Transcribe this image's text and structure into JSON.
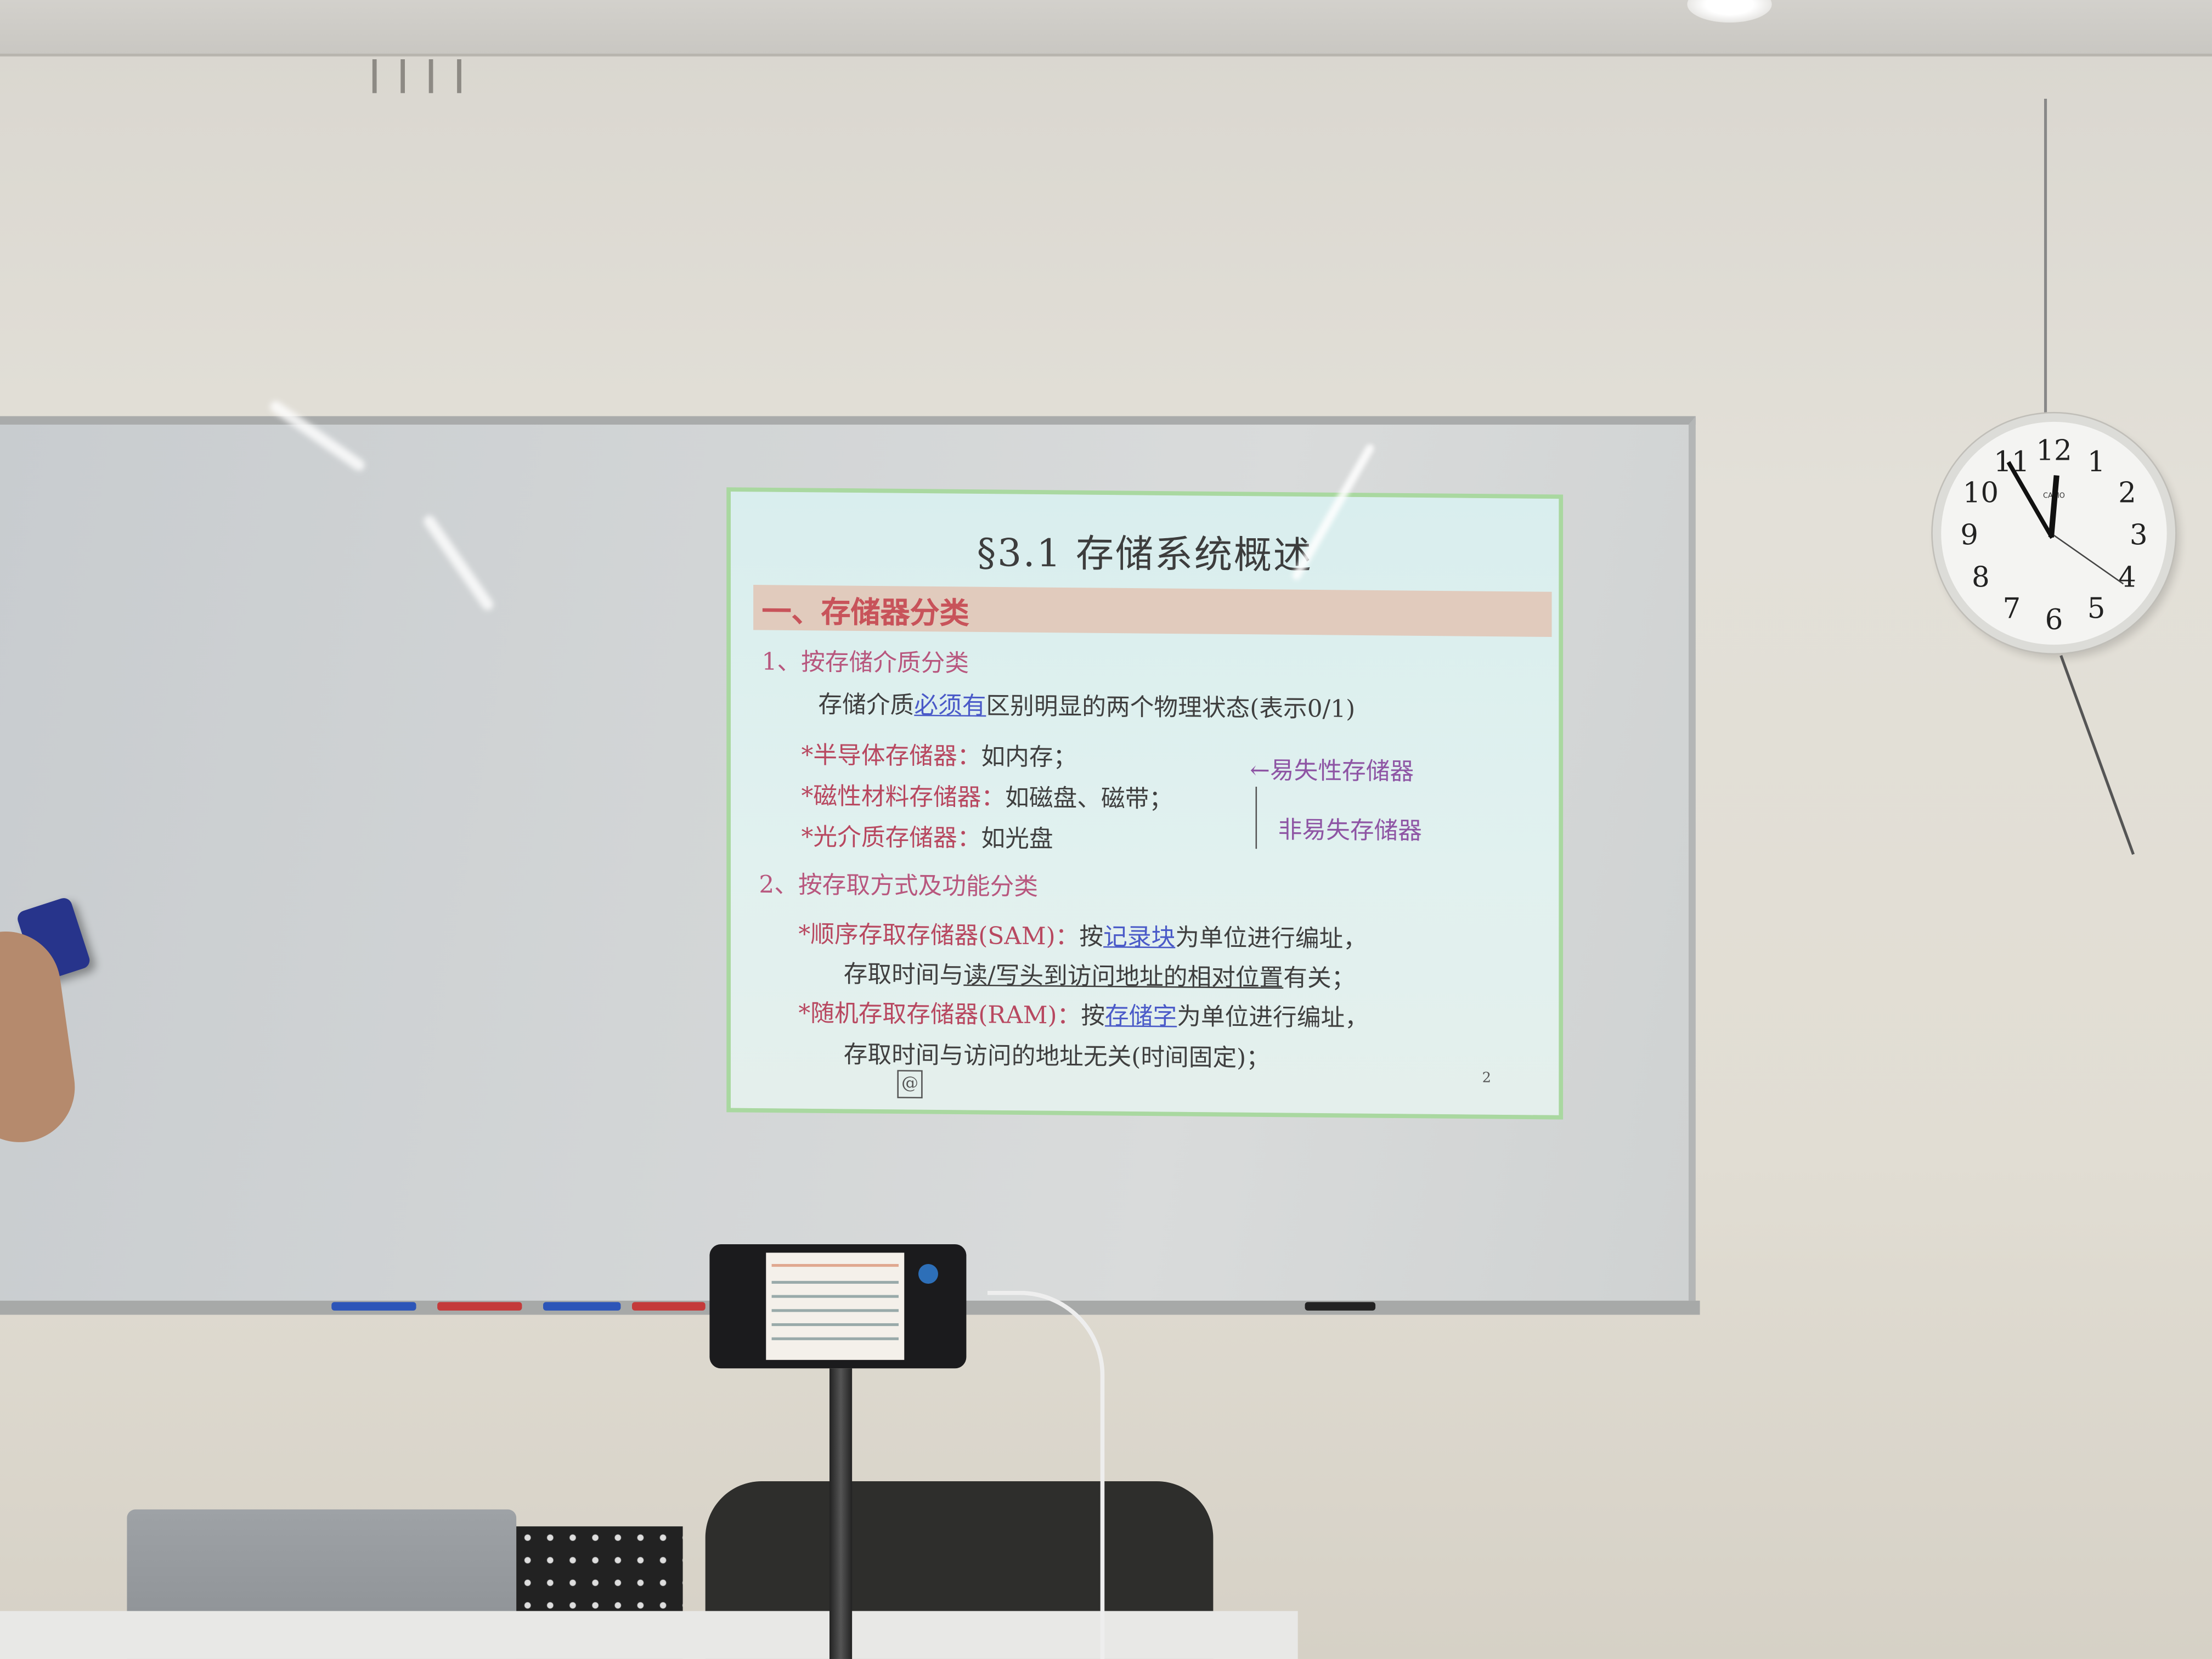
{
  "slide": {
    "title": "§3.1  存储系统概述",
    "section_heading": "一、存储器分类",
    "subsection1": "1、按存储介质分类",
    "intro": {
      "before": "存储介质",
      "emph": "必须有",
      "after": "区别明显的两个物理状态(表示0/1)"
    },
    "media": [
      {
        "name": "*半导体存储器：",
        "example": "如内存；"
      },
      {
        "name": "*磁性材料存储器：",
        "example": "如磁盘、磁带；"
      },
      {
        "name": "*光介质存储器：",
        "example": "如光盘"
      }
    ],
    "volatile_label": "←易失性存储器",
    "nonvolatile_label": "非易失存储器",
    "subsection2": "2、按存取方式及功能分类",
    "sam": {
      "name": "*顺序存取存储器(SAM)：",
      "pre": "按",
      "emph": "记录块",
      "post": "为单位进行编址，",
      "line2_pre": "存取时间与",
      "line2_emph": "读/写头到访问地址的相对位置",
      "line2_post": "有关；"
    },
    "ram": {
      "name": "*随机存取存储器(RAM)：",
      "pre": "按",
      "emph": "存储字",
      "post": "为单位进行编址，",
      "line2": "存取时间与访问的地址无关(时间固定)；"
    },
    "page_number": "2"
  },
  "clock": {
    "brand": "CASIO",
    "numbers": [
      "12",
      "1",
      "2",
      "3",
      "4",
      "5",
      "6",
      "7",
      "8",
      "9",
      "10",
      "11"
    ],
    "time": "10:55"
  },
  "colors": {
    "slide_bg": "#dcefee",
    "heading": "#c8535a",
    "subheading": "#b8577e",
    "link": "#4a5ac8",
    "band": "#e1cbbd"
  }
}
